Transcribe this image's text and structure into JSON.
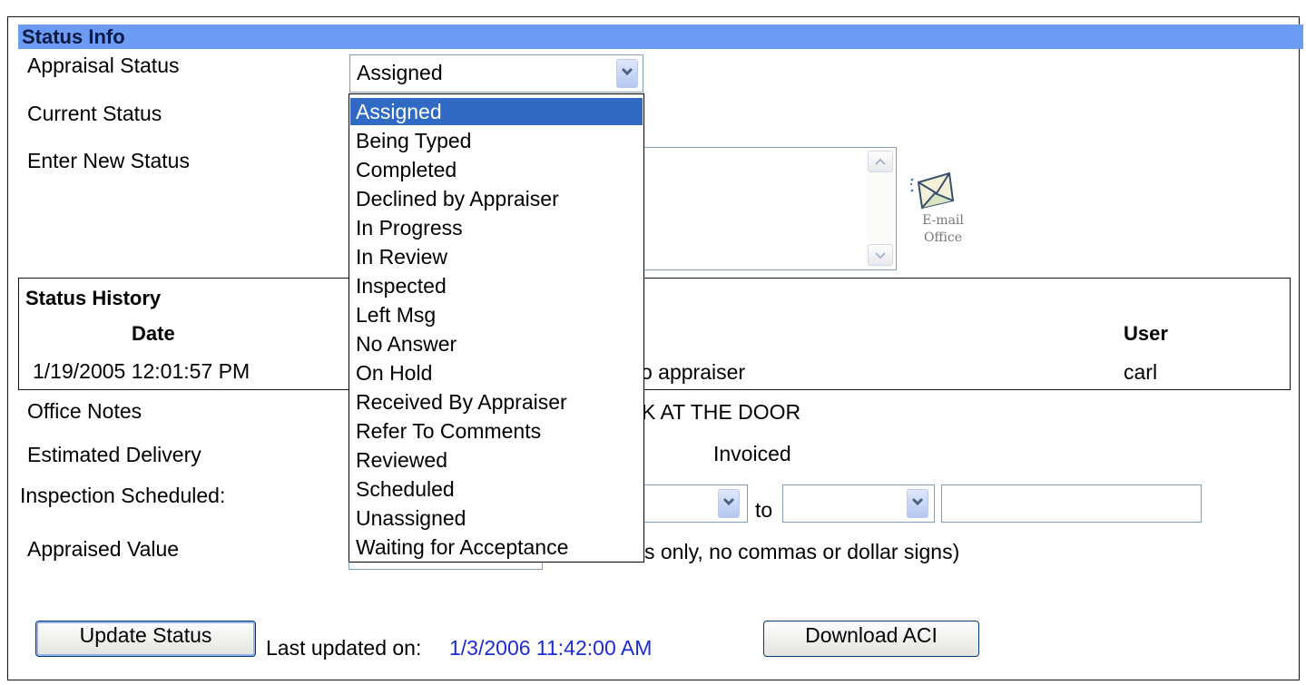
{
  "section_title": "Status Info",
  "appraisal_status": {
    "label": "Appraisal Status",
    "selected": "Assigned",
    "options": [
      "Assigned",
      "Being Typed",
      "Completed",
      "Declined by Appraiser",
      "In Progress",
      "In Review",
      "Inspected",
      "Left Msg",
      "No Answer",
      "On Hold",
      "Received By Appraiser",
      "Refer To Comments",
      "Reviewed",
      "Scheduled",
      "Unassigned",
      "Waiting for Acceptance"
    ]
  },
  "current_status": {
    "label": "Current Status"
  },
  "new_status": {
    "label": "Enter New Status",
    "value": ""
  },
  "email_office": {
    "line1": "E-mail",
    "line2": "Office",
    "icon": "envelope-icon"
  },
  "history": {
    "title": "Status History",
    "columns": {
      "date": "Date",
      "user": "User"
    },
    "rows": [
      {
        "date": "1/19/2005 12:01:57 PM",
        "status_fragment": "o appraiser",
        "user": "carl"
      }
    ]
  },
  "office_notes": {
    "label": "Office Notes",
    "value_fragment": "K AT THE DOOR"
  },
  "estimated_delivery": {
    "label": "Estimated Delivery",
    "invoiced_label": "Invoiced"
  },
  "inspection_scheduled": {
    "label": "Inspection Scheduled:",
    "to_label": "to",
    "note_value": ""
  },
  "appraised_value": {
    "label": "Appraised Value",
    "hint_fragment": "s only, no commas or dollar signs)"
  },
  "actions": {
    "update_label": "Update Status",
    "last_updated_label": "Last updated on:",
    "last_updated_value": "1/3/2006 11:42:00 AM",
    "download_label": "Download ACI"
  },
  "colors": {
    "header_bg": "#6b9bf3",
    "selection": "#316ac5",
    "link": "#1c2bd6"
  }
}
